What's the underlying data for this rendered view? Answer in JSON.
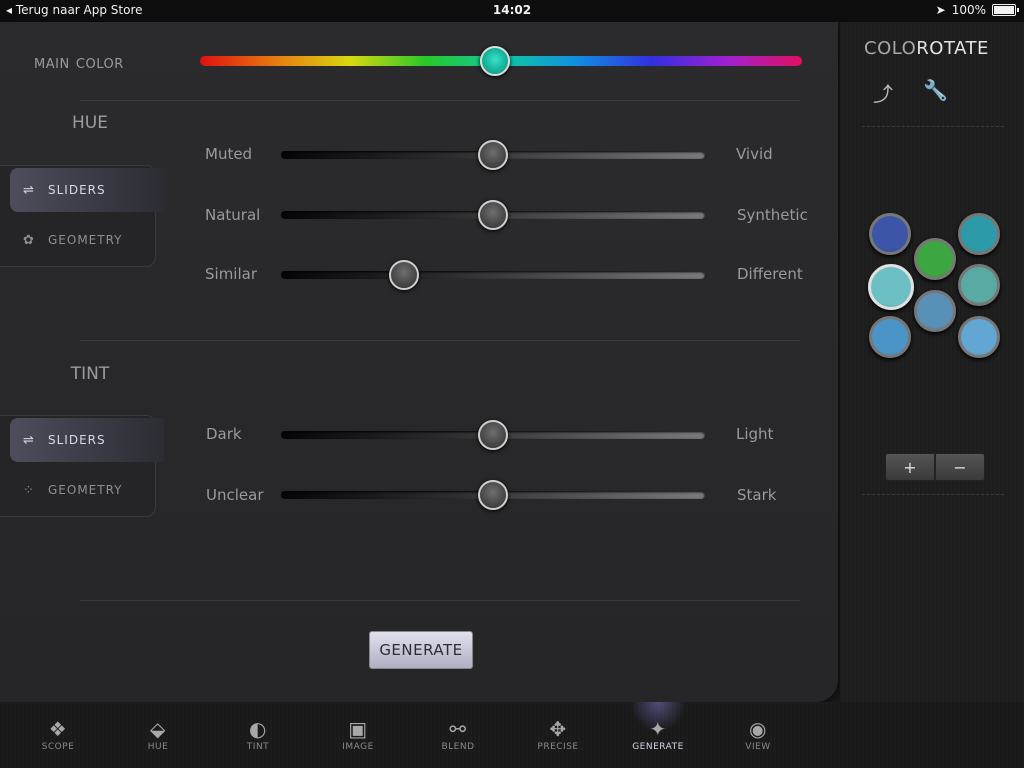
{
  "status": {
    "back": "Terug naar App Store",
    "time": "14:02",
    "battery": "100%"
  },
  "main_color": {
    "label": "MAIN COLOR",
    "position": 0.49,
    "color": "#17b8a0"
  },
  "hue": {
    "title": "HUE",
    "modes": [
      {
        "label": "SLIDERS",
        "icon": "sliders-icon",
        "active": true
      },
      {
        "label": "GEOMETRY",
        "icon": "geometry-icon",
        "active": false
      }
    ],
    "sliders": [
      {
        "left": "Muted",
        "right": "Vivid",
        "value": 0.5
      },
      {
        "left": "Natural",
        "right": "Synthetic",
        "value": 0.5
      },
      {
        "left": "Similar",
        "right": "Different",
        "value": 0.29
      }
    ]
  },
  "tint": {
    "title": "TINT",
    "modes": [
      {
        "label": "SLIDERS",
        "icon": "sliders-icon",
        "active": true
      },
      {
        "label": "GEOMETRY",
        "icon": "geometry-icon",
        "active": false
      }
    ],
    "sliders": [
      {
        "left": "Dark",
        "right": "Light",
        "value": 0.5
      },
      {
        "left": "Unclear",
        "right": "Stark",
        "value": 0.5
      }
    ]
  },
  "generate_button": "GENERATE",
  "sidebar": {
    "logo_a": "COLO",
    "logo_b": "ROTATE",
    "swatches": [
      "#3c55a8",
      "#2c9aa8",
      "#3ca640",
      "#6cc0c4",
      "#5aaaa4",
      "#5890b8",
      "#4a94c8",
      "#62a6d4"
    ],
    "plus": "+",
    "minus": "−"
  },
  "nav": [
    {
      "label": "SCOPE",
      "icon": "scope-icon"
    },
    {
      "label": "HUE",
      "icon": "hue-icon"
    },
    {
      "label": "TINT",
      "icon": "tint-icon"
    },
    {
      "label": "IMAGE",
      "icon": "image-icon"
    },
    {
      "label": "BLEND",
      "icon": "blend-icon"
    },
    {
      "label": "PRECISE",
      "icon": "precise-icon"
    },
    {
      "label": "GENERATE",
      "icon": "magic-wand-icon",
      "active": true
    },
    {
      "label": "VIEW",
      "icon": "eye-icon"
    }
  ]
}
